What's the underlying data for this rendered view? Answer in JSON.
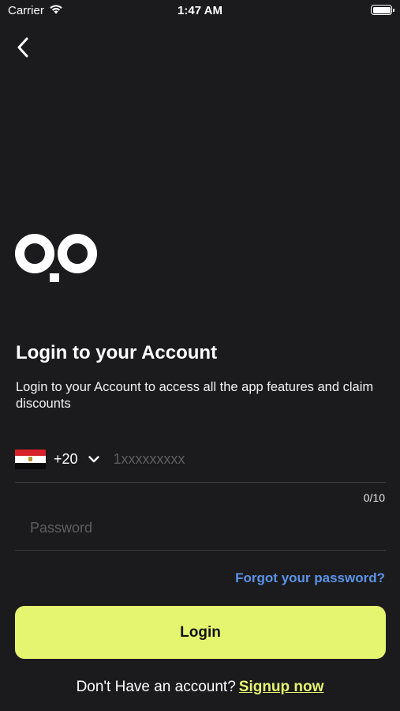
{
  "status_bar": {
    "carrier": "Carrier",
    "time": "1:47 AM",
    "wifi_icon": "wifi-icon",
    "battery_icon": "battery-icon"
  },
  "nav": {
    "back_icon": "chevron-left-icon"
  },
  "logo": {
    "icon": "brand-logo"
  },
  "header": {
    "title": "Login to your Account",
    "subtitle": "Login to your Account to access all the app features and claim discounts"
  },
  "phone": {
    "country_flag": "egypt-flag",
    "country_code": "+20",
    "value": "",
    "placeholder": "1xxxxxxxxx",
    "counter": "0/10"
  },
  "password": {
    "value": "",
    "placeholder": "Password"
  },
  "forgot_label": "Forgot your password?",
  "login_label": "Login",
  "signup": {
    "prompt": "Don't Have an account?",
    "link_label": "Signup now"
  },
  "colors": {
    "background": "#1b1b1d",
    "accent": "#e6f56f",
    "link_blue": "#5b93e8",
    "divider": "#3d3d40",
    "placeholder": "#5d5d62"
  }
}
